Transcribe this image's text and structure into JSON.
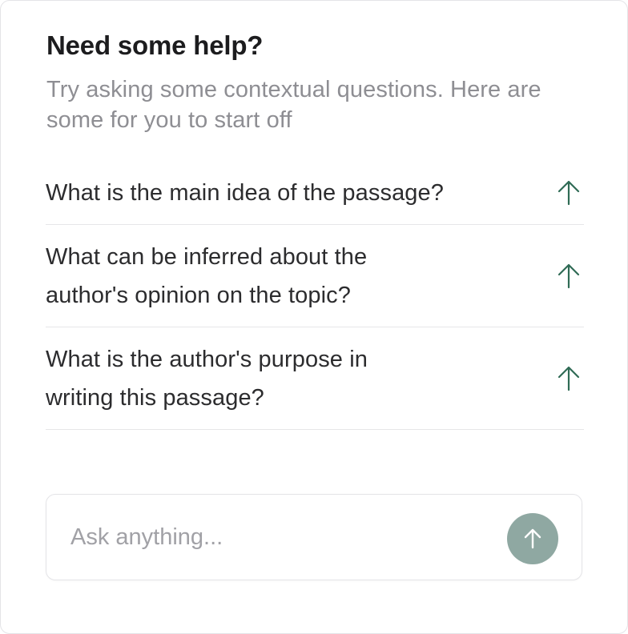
{
  "header": {
    "title": "Need some help?",
    "subtitle": "Try asking some contextual questions. Here are some for you to start off"
  },
  "suggestions": [
    {
      "text": "What is the main idea of the passage?",
      "icon": "arrow-up-icon"
    },
    {
      "text": "What can be inferred about the author's opinion on the topic?",
      "icon": "arrow-up-icon"
    },
    {
      "text": "What is the author's purpose in writing this passage?",
      "icon": "arrow-up-icon"
    }
  ],
  "composer": {
    "placeholder": "Ask anything...",
    "value": "",
    "send_icon": "arrow-up-icon"
  },
  "colors": {
    "accent": "#2f6b55",
    "send_button": "#8fa8a2",
    "title": "#1c1c1e",
    "muted": "#8e8e93"
  }
}
